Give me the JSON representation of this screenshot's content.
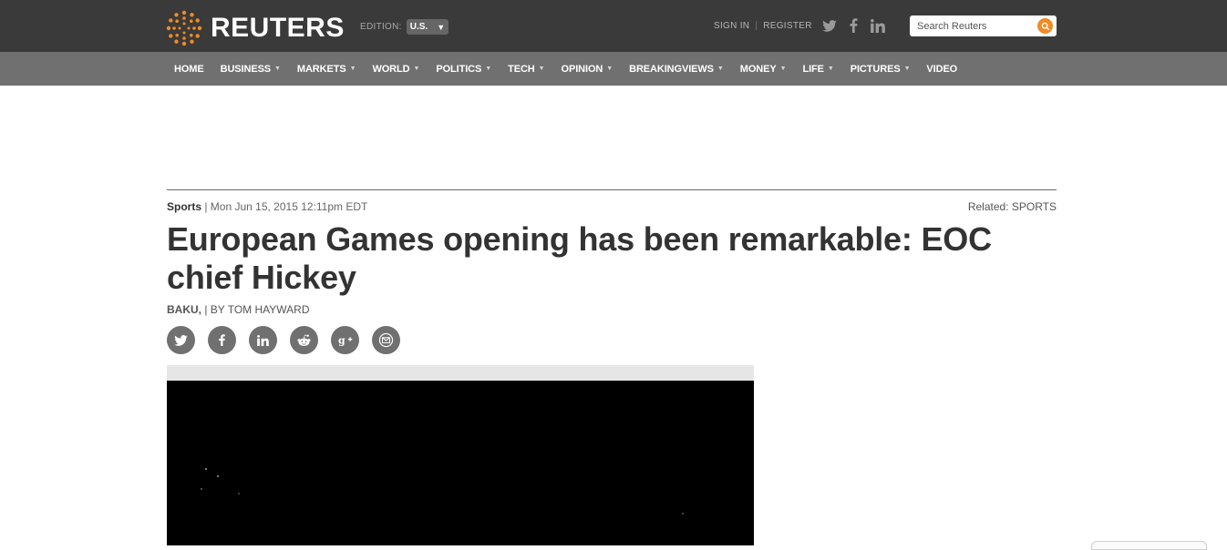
{
  "header": {
    "brand": "REUTERS",
    "edition_label": "EDITION:",
    "edition_value": "U.S.",
    "sign_in": "SIGN IN",
    "register": "REGISTER",
    "search_placeholder": "Search Reuters",
    "social": [
      "twitter-icon",
      "facebook-icon",
      "linkedin-icon"
    ]
  },
  "nav": {
    "items": [
      {
        "label": "HOME",
        "dropdown": false
      },
      {
        "label": "BUSINESS",
        "dropdown": true
      },
      {
        "label": "MARKETS",
        "dropdown": true
      },
      {
        "label": "WORLD",
        "dropdown": true
      },
      {
        "label": "POLITICS",
        "dropdown": true
      },
      {
        "label": "TECH",
        "dropdown": true
      },
      {
        "label": "OPINION",
        "dropdown": true
      },
      {
        "label": "BREAKINGVIEWS",
        "dropdown": true
      },
      {
        "label": "MONEY",
        "dropdown": true
      },
      {
        "label": "LIFE",
        "dropdown": true
      },
      {
        "label": "PICTURES",
        "dropdown": true
      },
      {
        "label": "VIDEO",
        "dropdown": false
      }
    ]
  },
  "article": {
    "section": "Sports",
    "date": "| Mon Jun 15, 2015 12:11pm EDT",
    "related": "Related: SPORTS",
    "headline": "European Games opening has been remarkable: EOC chief Hickey",
    "location": "BAKU,",
    "byline": "| BY TOM HAYWARD",
    "share_icons": [
      "twitter-icon",
      "facebook-icon",
      "linkedin-icon",
      "reddit-icon",
      "google-plus-icon",
      "email-icon"
    ]
  },
  "colors": {
    "topbar": "#3a3a3a",
    "navbar": "#707070",
    "accent": "#f08a24",
    "headline": "#333333"
  }
}
